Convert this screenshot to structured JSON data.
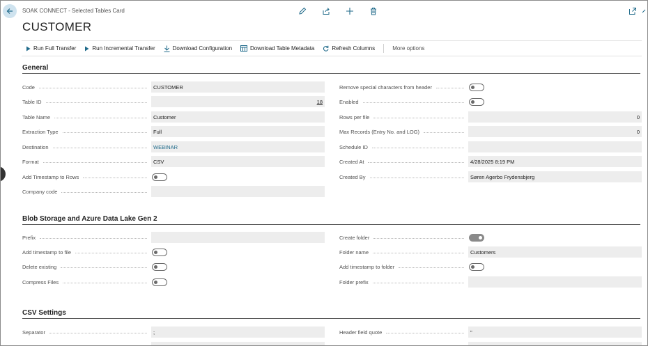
{
  "header": {
    "breadcrumb": "SOAK CONNECT - Selected Tables Card",
    "title": "CUSTOMER"
  },
  "actions": [
    {
      "label": "Run Full Transfer",
      "icon": "play-icon"
    },
    {
      "label": "Run Incremental Transfer",
      "icon": "play-icon"
    },
    {
      "label": "Download Configuration",
      "icon": "download-icon"
    },
    {
      "label": "Download Table Metadata",
      "icon": "table-icon"
    },
    {
      "label": "Refresh Columns",
      "icon": "refresh-icon"
    }
  ],
  "more_options": "More options",
  "sections": {
    "general": {
      "title": "General",
      "left": [
        {
          "label": "Code",
          "value": "CUSTOMER"
        },
        {
          "label": "Table ID",
          "value": "18"
        },
        {
          "label": "Table Name",
          "value": "Customer"
        },
        {
          "label": "Extraction Type",
          "value": "Full"
        },
        {
          "label": "Destination",
          "value": "WEBINAR"
        },
        {
          "label": "Format",
          "value": "CSV"
        },
        {
          "label": "Add Timestamp to Rows",
          "value": ""
        },
        {
          "label": "Company code",
          "value": ""
        }
      ],
      "right": [
        {
          "label": "Remove special characters from header",
          "value": ""
        },
        {
          "label": "Enabled",
          "value": ""
        },
        {
          "label": "Rows per file",
          "value": "0"
        },
        {
          "label": "Max Records (Entry No. and LOG)",
          "value": "0"
        },
        {
          "label": "Schedule ID",
          "value": ""
        },
        {
          "label": "Created At",
          "value": "4/28/2025 8:19 PM"
        },
        {
          "label": "Created By",
          "value": "Søren Agerbo Frydensbjerg"
        }
      ]
    },
    "blob": {
      "title": "Blob Storage and Azure Data Lake Gen 2",
      "left": [
        {
          "label": "Prefix",
          "value": ""
        },
        {
          "label": "Add timestamp to file",
          "value": ""
        },
        {
          "label": "Delete existing",
          "value": ""
        },
        {
          "label": "Compress Files",
          "value": ""
        }
      ],
      "right": [
        {
          "label": "Create folder",
          "value": ""
        },
        {
          "label": "Folder name",
          "value": "Customers"
        },
        {
          "label": "Add timestamp to folder",
          "value": ""
        },
        {
          "label": "Folder prefix",
          "value": ""
        }
      ]
    },
    "csv": {
      "title": "CSV Settings",
      "left": [
        {
          "label": "Separator",
          "value": ";"
        }
      ],
      "right": [
        {
          "label": "Header field quote",
          "value": "\""
        }
      ]
    }
  },
  "toggles": {
    "add_timestamp_to_rows": false,
    "remove_special_chars": false,
    "enabled": false,
    "add_timestamp_to_file": false,
    "delete_existing": false,
    "compress_files": false,
    "create_folder": true,
    "add_timestamp_to_folder": false
  },
  "colors": {
    "accent": "#1f6a8a",
    "field_bg": "#ededed"
  }
}
